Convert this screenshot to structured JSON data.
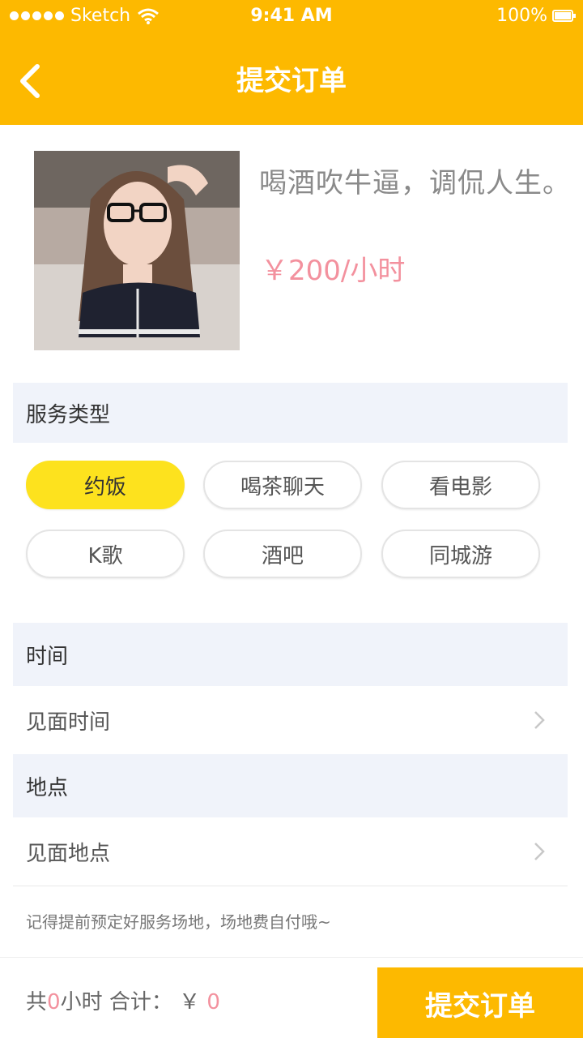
{
  "status_bar": {
    "carrier": "Sketch",
    "time": "9:41 AM",
    "battery": "100%"
  },
  "nav": {
    "title": "提交订单",
    "back_icon": "chevron-left-icon"
  },
  "profile": {
    "tagline": "喝酒吹牛逼，调侃人生。",
    "price": "￥200/小时"
  },
  "service": {
    "header": "服务类型",
    "options": [
      "约饭",
      "喝茶聊天",
      "看电影",
      "K歌",
      "酒吧",
      "同城游"
    ],
    "selected": "约饭"
  },
  "time_section": {
    "header": "时间",
    "row_label": "见面时间"
  },
  "location_section": {
    "header": "地点",
    "row_label": "见面地点"
  },
  "note": "记得提前预定好服务场地，场地费自付哦~",
  "footer": {
    "total_prefix": "共",
    "hours": "0",
    "hours_unit": "小时",
    "sum_label": "合计：",
    "currency": "￥",
    "amount": "0",
    "submit_label": "提交订单"
  },
  "colors": {
    "brand": "#FDB900",
    "selected_tag": "#FDE21E",
    "price": "#f3919e",
    "section_bg": "#f0f3fa"
  }
}
